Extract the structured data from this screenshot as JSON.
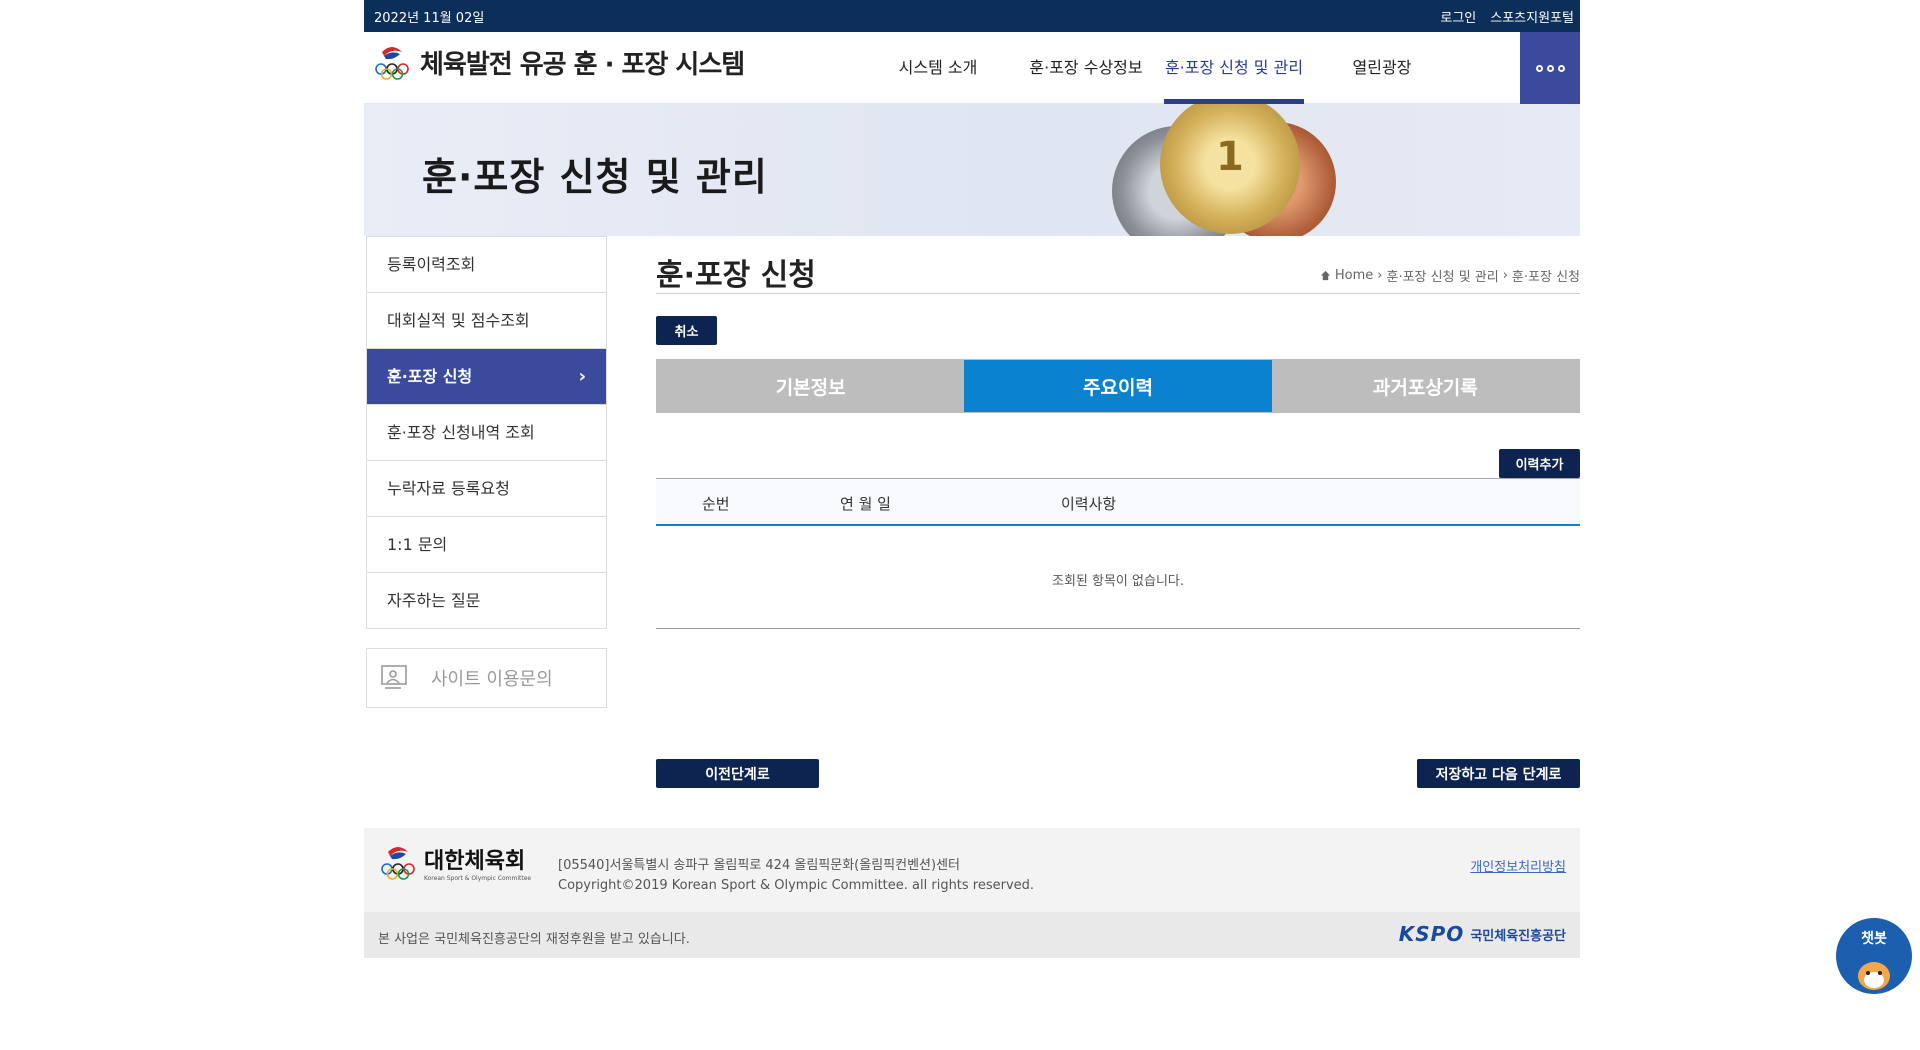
{
  "topbar": {
    "date": "2022년 11월 02일",
    "login": "로그인",
    "portal": "스포츠지원포털"
  },
  "header": {
    "logo_text": "체육발전 유공 훈 · 포장 시스템",
    "nav": [
      "시스템 소개",
      "훈·포장 수상정보",
      "훈·포장 신청 및 관리",
      "열린광장"
    ],
    "active_nav_index": 2
  },
  "banner": {
    "title": "훈·포장 신청 및 관리"
  },
  "sidebar": {
    "items": [
      {
        "label": "등록이력조회"
      },
      {
        "label": "대회실적 및 점수조회"
      },
      {
        "label": "훈·포장 신청"
      },
      {
        "label": "훈·포장 신청내역 조회"
      },
      {
        "label": "누락자료 등록요청"
      },
      {
        "label": "1:1 문의"
      },
      {
        "label": "자주하는 질문"
      }
    ],
    "active_index": 2,
    "inquiry": "사이트 이용문의"
  },
  "content": {
    "title": "훈·포장 신청",
    "breadcrumb": [
      "Home",
      "훈·포장 신청 및 관리",
      "훈·포장 신청"
    ],
    "cancel": "취소",
    "tabs": [
      "기본정보",
      "주요이력",
      "과거포상기록"
    ],
    "active_tab_index": 1,
    "add_history": "이력추가",
    "table_headers": [
      "순번",
      "연 월 일",
      "이력사항"
    ],
    "empty_message": "조회된 항목이 없습니다.",
    "prev_button": "이전단계로",
    "next_button": "저장하고 다음 단계로"
  },
  "footer": {
    "org_name": "대한체육회",
    "org_sub": "Korean Sport & Olympic Committee",
    "address": "[05540]서울특별시 송파구 올림픽로 424 올림픽문화(올림픽컨벤션)센터",
    "copyright": "Copyright©2019 Korean Sport & Olympic Committee. all rights reserved.",
    "privacy": "개인정보처리방침",
    "support": "본 사업은 국민체육진흥공단의 재정후원을 받고 있습니다.",
    "kspo": "KSPO",
    "kspo_name": "국민체육진흥공단"
  },
  "chatbot": {
    "label": "챗봇"
  },
  "colors": {
    "navy": "#0e2450",
    "accent_blue": "#0a82d0",
    "sidebar_active": "#3b4a9d",
    "topbar": "#0c2f5a"
  }
}
